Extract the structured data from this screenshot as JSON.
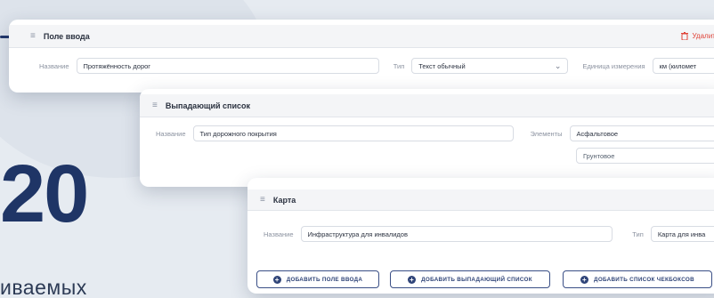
{
  "background": {
    "big_number": "20",
    "text_fragment": "иваемых"
  },
  "card_input": {
    "drag_icon": "≡",
    "title": "Поле ввода",
    "delete_label": "Удалить",
    "name_label": "Название",
    "name_value": "Протяжённость дорог",
    "type_label": "Тип",
    "type_value": "Текст обычный",
    "unit_label": "Единица измерения",
    "unit_value": "км (километ"
  },
  "card_dropdown": {
    "drag_icon": "≡",
    "title": "Выпадающий список",
    "name_label": "Название",
    "name_value": "Тип дорожного покрытия",
    "elements_label": "Элементы",
    "elements": [
      "Асфальтовое",
      "Грунтовое"
    ]
  },
  "card_map": {
    "drag_icon": "≡",
    "title": "Карта",
    "name_label": "Название",
    "name_value": "Инфраструктура для инвалидов",
    "type_label": "Тип",
    "type_value": "Карта для инва"
  },
  "actions": {
    "add_input": "ДОБАВИТЬ ПОЛЕ ВВОДА",
    "add_dropdown": "ДОБАВИТЬ ВЫПАДАЮЩИЙ СПИСОК",
    "add_checkbox_list": "ДОБАВИТЬ СПИСОК ЧЕКБОКСОВ"
  },
  "colors": {
    "accent": "#1f3566",
    "danger": "#e0453a",
    "button_border": "#3a4f86"
  }
}
